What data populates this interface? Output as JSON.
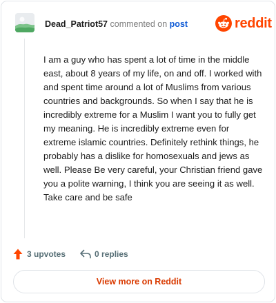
{
  "header": {
    "author": "Dead_Patriot57",
    "commented_text": "commented on",
    "post_link": "post",
    "brand_name": "reddit",
    "brand_color": "#ff4500",
    "avatar_icon": "default-avatar-icon"
  },
  "comment": {
    "body": "I am a guy who has spent a lot of time in the middle east, about 8 years of my life, on and off. I worked with and spent time around a lot of Muslims from various countries and backgrounds. So when I say that he is incredibly extreme for a Muslim I want you to fully get my meaning. He is incredibly extreme even for extreme islamic countries. Definitely rethink things, he probably has a dislike for homosexuals and jews as well. Please Be very careful, your Christian friend gave you a polite warning, I think you are seeing it as well. Take care and be safe"
  },
  "actions": {
    "upvotes": "3 upvotes",
    "replies": "0 replies",
    "upvote_icon": "upvote-arrow-icon",
    "reply_icon": "reply-arrow-icon",
    "upvote_color": "#ff4500"
  },
  "footer": {
    "view_more_label": "View more on Reddit",
    "view_more_color": "#d93a00"
  }
}
